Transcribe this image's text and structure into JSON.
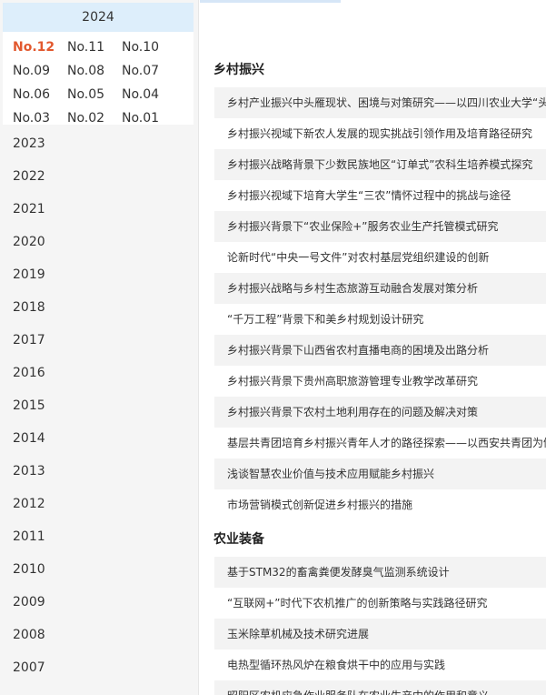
{
  "sidebar": {
    "current_year": "2024",
    "issues": [
      "No.12",
      "No.11",
      "No.10",
      "No.09",
      "No.08",
      "No.07",
      "No.06",
      "No.05",
      "No.04",
      "No.03",
      "No.02",
      "No.01"
    ],
    "active_issue": "No.12",
    "years": [
      "2023",
      "2022",
      "2021",
      "2020",
      "2019",
      "2018",
      "2017",
      "2016",
      "2015",
      "2014",
      "2013",
      "2012",
      "2011",
      "2010",
      "2009",
      "2008",
      "2007"
    ]
  },
  "main": {
    "sections": [
      {
        "title": "乡村振兴",
        "articles": [
          "乡村产业振兴中头雁现状、困境与对策研究——以四川农业大学“头雁”学员为例",
          "乡村振兴视域下新农人发展的现实挑战引领作用及培育路径研究",
          "乡村振兴战略背景下少数民族地区“订单式”农科生培养模式探究",
          "乡村振兴视域下培育大学生“三农”情怀过程中的挑战与途径",
          "乡村振兴背景下“农业保险+”服务农业生产托管模式研究",
          "论新时代“中央一号文件”对农村基层党组织建设的创新",
          "乡村振兴战略与乡村生态旅游互动融合发展对策分析",
          "“千万工程”背景下和美乡村规划设计研究",
          "乡村振兴背景下山西省农村直播电商的困境及出路分析",
          "乡村振兴背景下贵州高职旅游管理专业教学改革研究",
          "乡村振兴背景下农村土地利用存在的问题及解决对策",
          "基层共青团培育乡村振兴青年人才的路径探索——以西安共青团为例",
          "浅谈智慧农业价值与技术应用赋能乡村振兴",
          "市场营销模式创新促进乡村振兴的措施"
        ]
      },
      {
        "title": "农业装备",
        "articles": [
          "基于STM32的畜禽粪便发酵臭气监测系统设计",
          "“互联网+”时代下农机推广的创新策略与实践路径研究",
          "玉米除草机械及技术研究进展",
          "电热型循环热风炉在粮食烘干中的应用与实践",
          "昭阳区农机应急作业服务队在农业生产中的作用和意义"
        ]
      }
    ]
  }
}
